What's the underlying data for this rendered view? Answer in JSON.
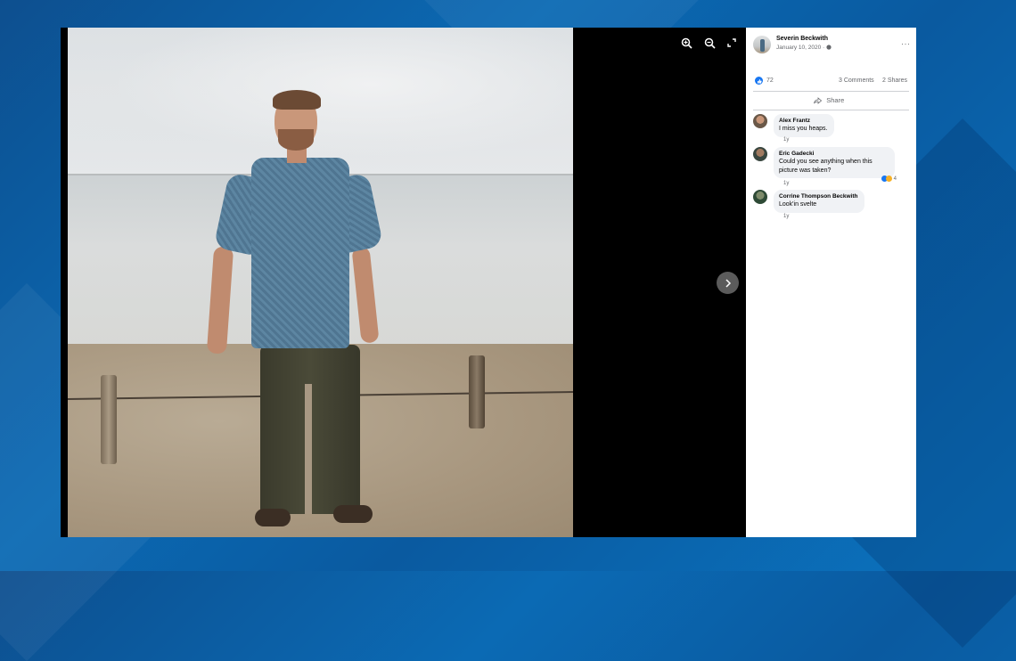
{
  "post": {
    "author": "Severin Beckwith",
    "date": "January 10, 2020 · ",
    "privacy_icon": "globe-icon",
    "more_icon": "more-icon",
    "more_label": "···"
  },
  "stats": {
    "likes": "72",
    "comments": "3 Comments",
    "shares": "2 Shares"
  },
  "actions": {
    "share_label": "Share"
  },
  "viewer": {
    "zoom_in_icon": "zoom-in-icon",
    "zoom_out_icon": "zoom-out-icon",
    "fullscreen_icon": "fullscreen-icon",
    "next_icon": "chevron-right-icon"
  },
  "comments": [
    {
      "name": "Alex Frantz",
      "text": "I miss you heaps.",
      "time": "1y"
    },
    {
      "name": "Eric Gadecki",
      "text": "Could you see anything when this picture was taken?",
      "time": "1y",
      "reactions": "4"
    },
    {
      "name": "Corrine Thompson Beckwith",
      "text": "Look'in svelte",
      "time": "1y"
    }
  ],
  "colors": {
    "accent": "#1877f2",
    "background": "#0b62ab",
    "viewer": "#000000"
  }
}
